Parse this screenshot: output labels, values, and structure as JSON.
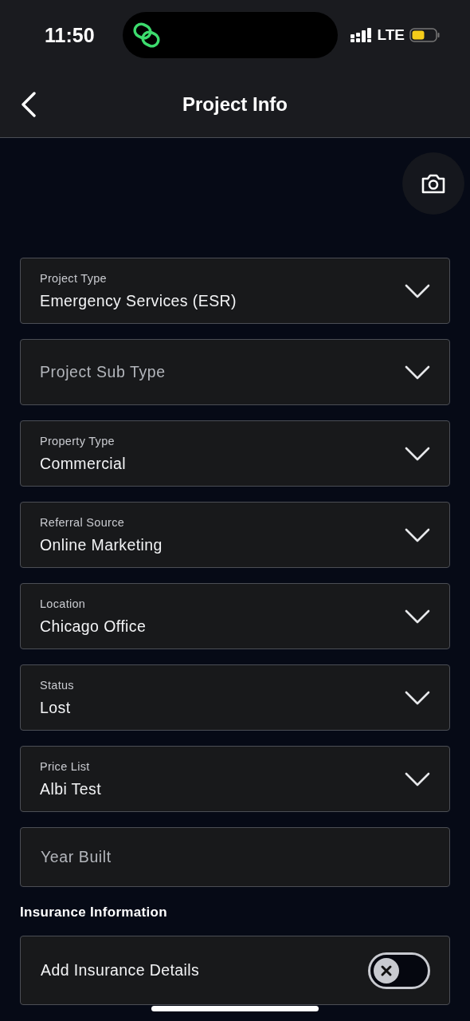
{
  "status_bar": {
    "time": "11:50",
    "network": "LTE"
  },
  "header": {
    "title": "Project Info"
  },
  "fields": [
    {
      "kind": "select",
      "label": "Project Type",
      "value": "Emergency Services (ESR)"
    },
    {
      "kind": "select",
      "placeholder": "Project Sub Type"
    },
    {
      "kind": "select",
      "label": "Property Type",
      "value": "Commercial"
    },
    {
      "kind": "select",
      "label": "Referral Source",
      "value": "Online Marketing"
    },
    {
      "kind": "select",
      "label": "Location",
      "value": "Chicago Office"
    },
    {
      "kind": "select",
      "label": "Status",
      "value": "Lost"
    },
    {
      "kind": "select",
      "label": "Price List",
      "value": "Albi Test"
    },
    {
      "kind": "input",
      "placeholder": "Year Built"
    }
  ],
  "insurance": {
    "heading": "Insurance Information",
    "toggle": {
      "label": "Add Insurance Details",
      "on": false
    }
  }
}
